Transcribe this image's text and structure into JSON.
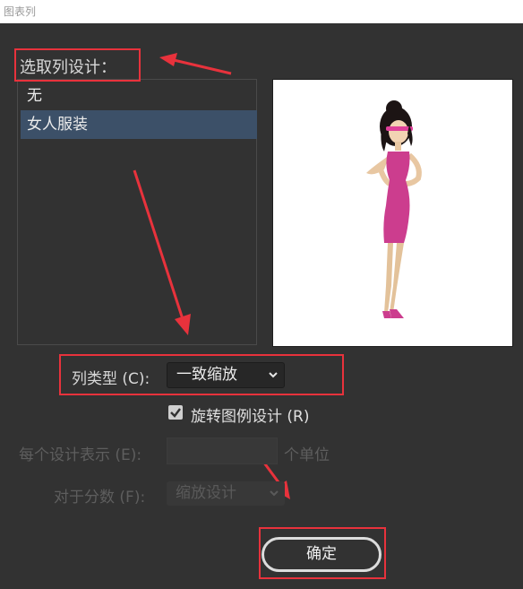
{
  "window": {
    "title": "图表列"
  },
  "column_design": {
    "label": "选取列设计：",
    "items": [
      {
        "label": "无",
        "selected": false
      },
      {
        "label": "女人服装",
        "selected": true
      }
    ]
  },
  "column_type": {
    "label": "列类型 (C):",
    "value": "一致缩放"
  },
  "rotate_legend": {
    "label": "旋转图例设计 (R)",
    "checked": true
  },
  "each_design": {
    "label": "每个设计表示 (E):",
    "value": "",
    "unit": "个单位"
  },
  "fraction": {
    "label": "对于分数 (F):",
    "value": "缩放设计"
  },
  "ok_button": {
    "label": "确定"
  },
  "colors": {
    "highlight": "#e8323c",
    "selection": "#3c5068",
    "dress": "#cc3d8e"
  }
}
